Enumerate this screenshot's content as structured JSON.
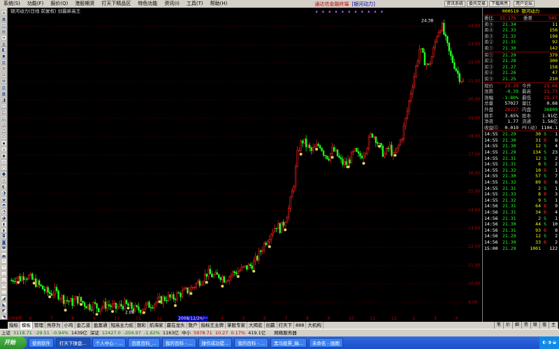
{
  "menu": {
    "items": [
      "系统(S)",
      "功能(F)",
      "报价(Q)",
      "港股期货",
      "打天下精品区",
      "特色功能",
      "资讯(I)",
      "工具(T)",
      "帮助(H)"
    ],
    "brand": "通达信金融终端",
    "brand_stock": "[银河动力]",
    "right_buttons": [
      "资讯系统",
      "委托交易",
      "下载高亮",
      "用户论坛"
    ]
  },
  "title": {
    "text": "银河动力(日线 前复权) 创最新高王",
    "marks": "▴ ▴ ▴ ▴ ▴ ▴ ▴ ▴ ▴ ▴ ▴"
  },
  "left_toolbar": [
    "≡",
    "▦",
    "◫",
    "▤",
    "⌗",
    "▥",
    "◧",
    "▣",
    "▨",
    "⊞",
    "⊟",
    "⊠",
    "▧",
    "▩",
    "◨",
    "▢",
    "◰",
    "◱",
    "◲",
    "◳",
    "⊡",
    "▪",
    "▫",
    "◆",
    "◇",
    "○",
    "●",
    "◎",
    "◐",
    "◑",
    "◒",
    "◓",
    "◔",
    "◕",
    "◖",
    "◗",
    "◘",
    "◙",
    "◚",
    "◛",
    "◜",
    "◝",
    "◞",
    "◟",
    "◠",
    "◡",
    "◢",
    "◣",
    "◤",
    "◥"
  ],
  "chart_data": {
    "type": "candlestick",
    "title": "银河动力(日线 前复权) 创最新高王",
    "ylim": [
      8.3,
      24.4
    ],
    "yticks": [
      "24.00",
      "23.00",
      "22.00",
      "21.00",
      "20.00",
      "19.00",
      "18.00",
      "17.00",
      "16.00",
      "15.00",
      "14.00",
      "13.00",
      "12.00",
      "11.00",
      "10.00",
      "9.00"
    ],
    "x_date_labels": [
      "2008年",
      "6",
      "7",
      "8",
      "9",
      "10",
      "11",
      "12",
      "2008/12/29/一",
      "3",
      "4",
      "5",
      "6",
      "7",
      "8",
      "9",
      "10",
      "11",
      "12",
      "2",
      "3",
      "4"
    ],
    "annotations": [
      {
        "text": "24.38",
        "value": 24.38
      },
      {
        "text": "2.08",
        "value": 8.7
      }
    ],
    "closes": [
      10.2,
      10.4,
      10.3,
      10.5,
      10.4,
      10.2,
      10.0,
      9.8,
      9.6,
      9.5,
      9.6,
      9.4,
      9.2,
      9.1,
      9.0,
      9.2,
      9.1,
      8.9,
      8.8,
      8.9,
      8.7,
      8.8,
      8.9,
      8.8,
      8.7,
      8.8,
      8.9,
      8.8,
      8.7,
      8.6,
      8.7,
      8.8,
      8.9,
      9.0,
      9.1,
      9.2,
      9.3,
      9.2,
      9.4,
      9.5,
      9.6,
      9.7,
      9.9,
      10.1,
      10.3,
      10.6,
      10.5,
      10.4,
      10.5,
      10.3,
      10.4,
      10.6,
      10.7,
      10.8,
      10.9,
      11.0,
      11.2,
      11.6,
      12.1,
      12.5,
      12.9,
      13.2,
      13.0,
      13.5,
      14.2,
      15.4,
      17.3,
      17.8,
      17.5,
      17.2,
      17.4,
      17.6,
      17.1,
      16.9,
      17.3,
      17.0,
      16.6,
      16.5,
      16.8,
      17.2,
      16.9,
      17.1,
      17.6,
      18.2,
      17.9,
      17.3,
      17.0,
      17.5,
      16.9,
      17.4,
      18.1,
      19.2,
      20.5,
      21.6,
      22.8,
      22.2,
      21.8,
      22.5,
      23.6,
      24.1,
      23.2,
      22.4,
      21.9,
      21.3,
      21.0
    ]
  },
  "right_panel": {
    "code": "000519",
    "name": "银河动力",
    "wei_bi_label": "委比",
    "wei_bi": "33.17%",
    "wei_cha_label": "委差",
    "wei_cha": "545",
    "sells": [
      {
        "label": "卖⑤",
        "price": "21.34",
        "vol": "11"
      },
      {
        "label": "卖④",
        "price": "21.33",
        "vol": "156"
      },
      {
        "label": "卖③",
        "price": "21.32",
        "vol": "198"
      },
      {
        "label": "卖②",
        "price": "21.31",
        "vol": "92"
      },
      {
        "label": "卖①",
        "price": "21.30",
        "vol": "142"
      }
    ],
    "buys": [
      {
        "label": "买①",
        "price": "21.29",
        "vol": "379"
      },
      {
        "label": "买②",
        "price": "21.28",
        "vol": "300"
      },
      {
        "label": "买③",
        "price": "21.27",
        "vol": "158"
      },
      {
        "label": "买④",
        "price": "21.26",
        "vol": "47"
      },
      {
        "label": "买⑤",
        "price": "21.25",
        "vol": "210"
      }
    ],
    "quote_rows": [
      {
        "l1": "现价",
        "v1": "21.29",
        "l2": "今开",
        "v2": "21.66"
      },
      {
        "l1": "涨跌",
        "v1": "-0.39",
        "l2": "最高",
        "v2": "21.73"
      },
      {
        "l1": "涨幅",
        "v1": "-1.80%",
        "l2": "最低",
        "v2": "21.27"
      },
      {
        "l1": "总量",
        "v1": "57027",
        "l2": "量比",
        "v2": "0.68"
      },
      {
        "l1": "外盘",
        "v1": "20227",
        "l2": "内盘",
        "v2": "36800"
      },
      {
        "l1": "换手",
        "v1": "3.65%",
        "l2": "股本",
        "v2": "1.91亿"
      },
      {
        "l1": "净资",
        "v1": "1.77",
        "l2": "流通",
        "v2": "1.56亿"
      },
      {
        "l1": "收益㈢",
        "v1": "0.019",
        "l2": "PE(动)",
        "v2": "1104.1"
      }
    ],
    "ticks": [
      {
        "time": "14:55",
        "price": "21.29",
        "vol": "30",
        "bs": "S",
        "n": "1"
      },
      {
        "time": "14:55",
        "price": "21.30",
        "vol": "31",
        "bs": "B",
        "n": "6"
      },
      {
        "time": "14:55",
        "price": "21.30",
        "vol": "12",
        "bs": "S",
        "n": "4"
      },
      {
        "time": "14:55",
        "price": "21.29",
        "vol": "134",
        "bs": "S",
        "n": "23"
      },
      {
        "time": "14:55",
        "price": "21.31",
        "vol": "12",
        "bs": "S",
        "n": "2"
      },
      {
        "time": "14:55",
        "price": "21.31",
        "vol": "6",
        "bs": "S",
        "n": "2"
      },
      {
        "time": "14:55",
        "price": "21.32",
        "vol": "10",
        "bs": "B",
        "n": "1"
      },
      {
        "time": "14:55",
        "price": "21.30",
        "vol": "57",
        "bs": "S",
        "n": "7"
      },
      {
        "time": "14:55",
        "price": "21.32",
        "vol": "89",
        "bs": "B",
        "n": "6"
      },
      {
        "time": "14:55",
        "price": "21.31",
        "vol": "2",
        "bs": "S",
        "n": "1"
      },
      {
        "time": "14:55",
        "price": "21.33",
        "vol": "8",
        "bs": "B",
        "n": "3"
      },
      {
        "time": "14:55",
        "price": "21.32",
        "vol": "9",
        "bs": "S",
        "n": "1"
      },
      {
        "time": "14:56",
        "price": "21.31",
        "vol": "64",
        "bs": "B",
        "n": "9"
      },
      {
        "time": "14:56",
        "price": "21.31",
        "vol": "34",
        "bs": "B",
        "n": "4"
      },
      {
        "time": "14:56",
        "price": "21.31",
        "vol": "2",
        "bs": "S",
        "n": "1"
      },
      {
        "time": "14:56",
        "price": "21.30",
        "vol": "44",
        "bs": "S",
        "n": "10"
      },
      {
        "time": "14:56",
        "price": "21.31",
        "vol": "93",
        "bs": "B",
        "n": "8"
      },
      {
        "time": "14:56",
        "price": "21.29",
        "vol": "12",
        "bs": "S",
        "n": "2"
      },
      {
        "time": "14:56",
        "price": "21.30",
        "vol": "33",
        "bs": "B",
        "n": "2"
      },
      {
        "time": "15:00",
        "price": "21.29",
        "vol": "1001",
        "bs": "",
        "n": "122"
      }
    ],
    "footer": [
      "日线",
      "笔",
      "价",
      "细",
      "势",
      "联",
      "值",
      "主"
    ]
  },
  "tabs": [
    "指标",
    "模板",
    "管理",
    "亮存为",
    "小鸡",
    "金乙道",
    "盈富通",
    "短高主力蛇",
    "题彩",
    "航海家",
    "赢在龙头",
    "散户",
    "指标王主牌",
    "掌股专家",
    "大揭宏",
    "创赢",
    "打天下",
    "888",
    "大机构"
  ],
  "tabs_active_index": 1,
  "status": {
    "sh_label": "上证",
    "sh_value": "3118.71",
    "sh_change": "-29.51",
    "sh_pct": "-0.94%",
    "sh_amount": "1439亿",
    "sz_label": "深证",
    "sz_value": "12427.0",
    "sz_change": "-204.97",
    "sz_pct": "-1.62%",
    "sz_amount": "1163亿",
    "zx_label": "中小",
    "zx_value": "5978.71",
    "zx_change": "10.27",
    "zx_pct": "0.17%",
    "zx_amount": "419.1亿",
    "server": "网络服务器"
  },
  "taskbar": {
    "start": "开始",
    "items": [
      "使用软件",
      "打天下操盘...",
      "个人中心 - ...",
      "百度百科_...",
      "我的百科 - ...",
      "操作成功提...",
      "我的百科 - ...",
      "黑马股票_输...",
      "未命名 - 画图"
    ],
    "active_index": 1,
    "tray": "◐ ◑ ◒"
  },
  "colors": {
    "up": "#ff2020",
    "down": "#20ff20",
    "grid": "#800000",
    "axis_text": "#c00000"
  }
}
